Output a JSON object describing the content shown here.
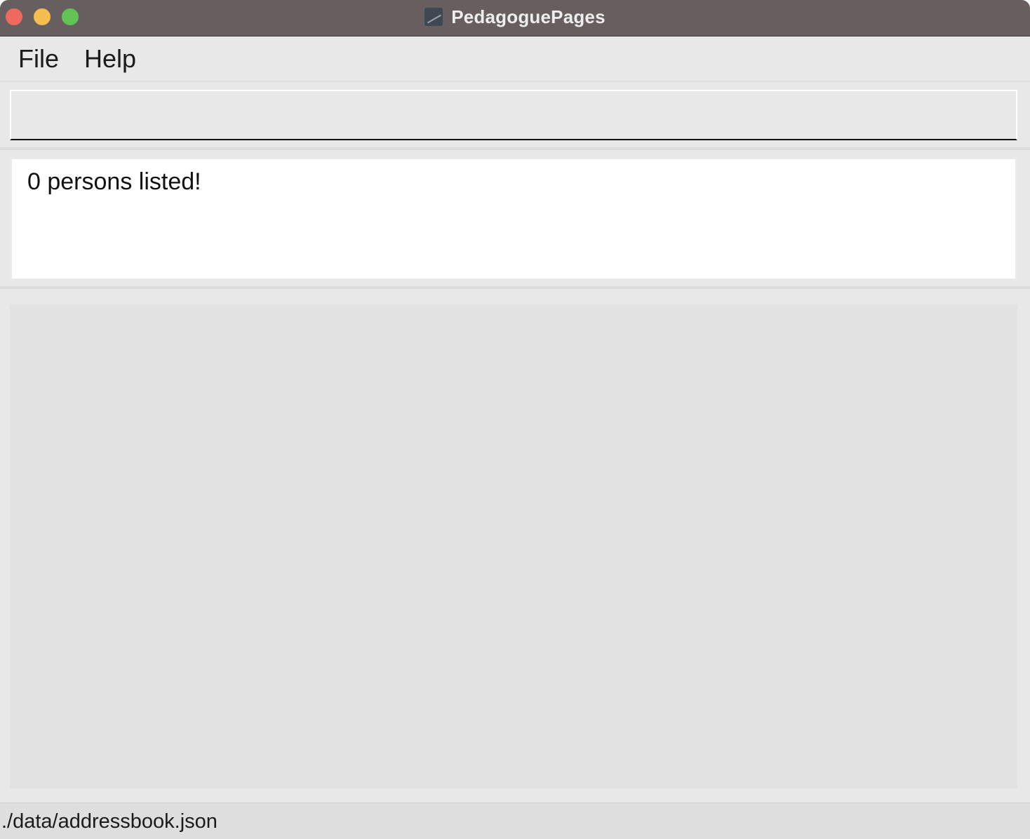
{
  "window": {
    "title": "PedagoguePages",
    "app_icon": "app-icon"
  },
  "menu": {
    "items": [
      {
        "label": "File"
      },
      {
        "label": "Help"
      }
    ]
  },
  "command_box": {
    "value": "",
    "placeholder": ""
  },
  "result_display": {
    "message": "0 persons listed!"
  },
  "person_list": {
    "items": []
  },
  "status_bar": {
    "save_location": "./data/addressbook.json"
  },
  "colors": {
    "titlebar": "#675f5f",
    "close": "#ee6a5e",
    "minimize": "#f5bd4f",
    "maximize": "#61c454",
    "background": "#e8e8e8"
  }
}
